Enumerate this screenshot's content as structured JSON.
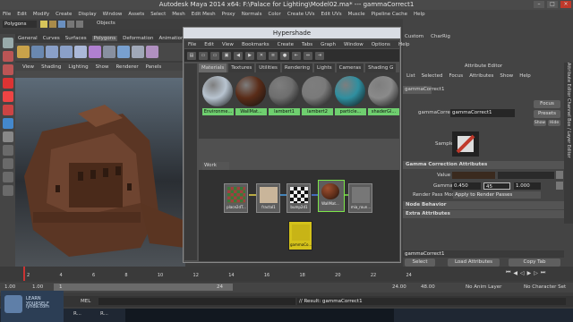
{
  "window": {
    "title": "Autodesk Maya 2014 x64: F:\\Palace for Lighting\\Model02.ma* --- gammaCorrect1"
  },
  "main_menu": [
    "File",
    "Edit",
    "Modify",
    "Create",
    "Display",
    "Window",
    "Assets",
    "Select",
    "Mesh",
    "Edit Mesh",
    "Proxy",
    "Normals",
    "Color",
    "Create UVs",
    "Edit UVs",
    "Muscle",
    "Pipeline Cache",
    "Help"
  ],
  "status_line": {
    "mode": "Polygons",
    "objects_label": "Objects"
  },
  "shelf_tabs": [
    "General",
    "Curves",
    "Surfaces",
    "Polygons",
    "Deformation",
    "Animation"
  ],
  "shelf_active": "Polygons",
  "viewport_menu": [
    "View",
    "Shading",
    "Lighting",
    "Show",
    "Renderer",
    "Panels"
  ],
  "right_shelf_tabs": [
    "Custom",
    "CharRig"
  ],
  "hypershade": {
    "title": "Hypershade",
    "menu": [
      "File",
      "Edit",
      "View",
      "Bookmarks",
      "Create",
      "Tabs",
      "Graph",
      "Window",
      "Options",
      "Help"
    ],
    "tabs": [
      "Materials",
      "Textures",
      "Utilities",
      "Rendering",
      "Lights",
      "Cameras",
      "Shading G"
    ],
    "active_tab": "Materials",
    "materials": [
      {
        "label": "Environme...",
        "color": "#b8c4d0"
      },
      {
        "label": "WallMat...",
        "color": "#5a2c18"
      },
      {
        "label": "lambert1",
        "color": "#6e6e6e"
      },
      {
        "label": "lambert2",
        "color": "#7a7a7a"
      },
      {
        "label": "particle...",
        "color": "#2f8fa0"
      },
      {
        "label": "shaderGl...",
        "color": "#8a8a8a"
      }
    ],
    "work_area_tab": "Work Area",
    "nodes": [
      {
        "label": "place2dT...",
        "color": "#a04040"
      },
      {
        "label": "fractal1",
        "color": "#c9b59a"
      },
      {
        "label": "bump2d1",
        "color": "#eeeeee"
      },
      {
        "label": "WallMat...",
        "color": "#5a2c18"
      },
      {
        "label": "mia_roun...",
        "color": "#777777"
      },
      {
        "label": "gammaCo...",
        "color": "#d4c21a"
      }
    ]
  },
  "attribute_editor": {
    "title": "Attribute Editor",
    "menu": [
      "List",
      "Selected",
      "Focus",
      "Attributes",
      "Show",
      "Help"
    ],
    "node_tab": "gammaCorrect1",
    "node_label": "gammaCorrect:",
    "node_name": "gammaCorrect1",
    "focus_label": "Focus",
    "presets_label": "Presets",
    "show_label": "Show",
    "hide_label": "Hide",
    "sample_label": "Sample",
    "section_gamma": "Gamma Correction Attributes",
    "value_label": "Value",
    "gamma_label": "Gamma",
    "gamma_values": [
      "0.450",
      "45",
      "1.000"
    ],
    "render_pass_label": "Render Pass Mode",
    "render_pass_value": "Apply to Render Passes",
    "node_behavior": "Node Behavior",
    "extra_attributes": "Extra Attributes",
    "bottom_field": "gammaCorrect1",
    "select_label": "Select",
    "load_label": "Load Attributes",
    "copy_label": "Copy Tab",
    "side_tabs": "Attribute Editor   Channel Box / Layer Editor"
  },
  "timeline": {
    "ticks": [
      "2",
      "4",
      "6",
      "8",
      "10",
      "12",
      "14",
      "16",
      "18",
      "20",
      "22",
      "24"
    ],
    "current": "1"
  },
  "range": {
    "start": "1.00",
    "inner_start": "1.00",
    "marker": "1",
    "inner_end": "24",
    "end_a": "24.00",
    "end_b": "48.00",
    "anim_layer": "No Anim Layer",
    "char_set": "No Character Set"
  },
  "command_line": {
    "label": "MEL",
    "result": "// Result: gammaCorrect1"
  },
  "taskbar": {
    "logo_line1": "LEARN YOURSELF",
    "logo_line2": "lynda.com",
    "items": [
      "R...",
      "R..."
    ]
  }
}
